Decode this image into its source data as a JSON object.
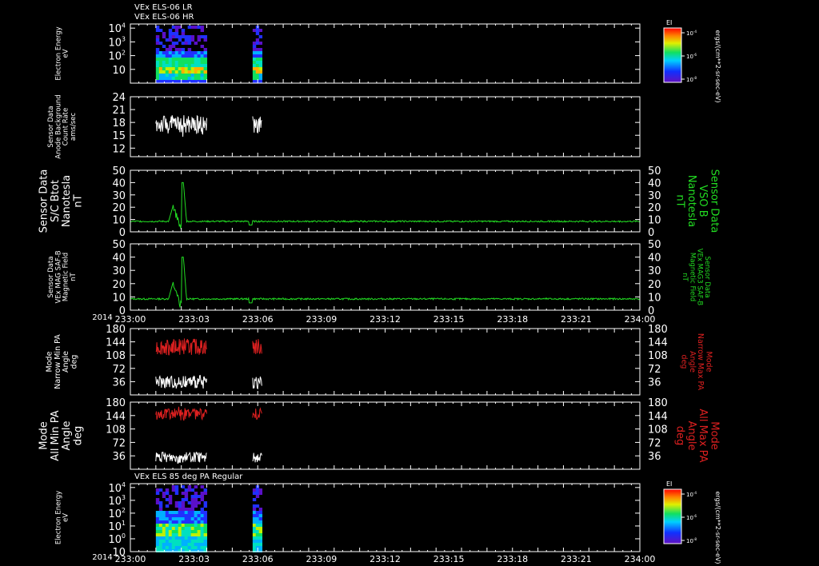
{
  "colors": {
    "white": "#ffffff",
    "green": "#22dd22",
    "red": "#dd2020",
    "background": "#000000"
  },
  "x_axis": {
    "year_label": "2014",
    "ticks": [
      "233:00",
      "233:03",
      "233:06",
      "233:09",
      "233:12",
      "233:15",
      "233:18",
      "233:21",
      "234:00"
    ],
    "range_minutes": [
      0,
      60
    ]
  },
  "chart_data": [
    {
      "type": "heatmap",
      "title_lines": [
        "VEx ELS-06 LR",
        "VEx ELS-06 HR"
      ],
      "ylabel": [
        "Electron Energy",
        "eV"
      ],
      "yticks": [
        {
          "base": "10",
          "exp": "4",
          "value": 10000
        },
        {
          "base": "10",
          "exp": "3",
          "value": 1000
        },
        {
          "base": "10",
          "exp": "2",
          "value": 100
        },
        {
          "base": "10",
          "exp": "",
          "value": 10
        }
      ],
      "ylim": [
        1,
        20000
      ],
      "yscale": "log",
      "time_intervals_minutes": [
        [
          3.0,
          9.0
        ],
        [
          14.4,
          15.5
        ]
      ],
      "colorbar": {
        "label": "EI",
        "unit": "ergs/(cm**2-sr-sec-eV)",
        "ticks": [
          {
            "base": "10",
            "exp": "-4"
          },
          {
            "base": "10",
            "exp": "-6"
          },
          {
            "base": "10",
            "exp": "-8"
          }
        ]
      }
    },
    {
      "type": "line",
      "ylabel": [
        "Sensor Data",
        "Anode Background",
        "Count Rate",
        "ams/sec"
      ],
      "yticks": [
        "24",
        "21",
        "18",
        "15",
        "12"
      ],
      "ylim": [
        10,
        24
      ],
      "series": [
        {
          "color": "white",
          "segments": [
            [
              3.0,
              9.0
            ],
            [
              14.4,
              15.5
            ]
          ],
          "mean": 17.5,
          "noise": 2.2
        }
      ]
    },
    {
      "type": "line",
      "ylabel": [
        "Sensor Data",
        "S/C Btot",
        "Nanotesla",
        "nT"
      ],
      "right_label": [
        "Sensor Data",
        "VSO B",
        "Nanotesla",
        "nT"
      ],
      "yticks": [
        "50",
        "40",
        "30",
        "20",
        "10",
        "0"
      ],
      "ylim": [
        0,
        50
      ],
      "series": [
        {
          "color": "green"
        }
      ]
    },
    {
      "type": "line",
      "ylabel": [
        "Sensor Data",
        "VEx MAG SAF-B",
        "Magnetic Field",
        "nT"
      ],
      "right_label": [
        "Sensor Data",
        "VEx MAG3 SAF-B",
        "Magnetic Field",
        "nT"
      ],
      "yticks": [
        "50",
        "40",
        "30",
        "20",
        "10",
        "0"
      ],
      "ylim": [
        0,
        50
      ],
      "series": [
        {
          "color": "green"
        }
      ]
    },
    {
      "type": "line",
      "ylabel": [
        "Mode",
        "Narrow Min PA",
        "Angle",
        "deg"
      ],
      "right_label": [
        "Mode",
        "Narrow Max PA",
        "Angle",
        "deg"
      ],
      "yticks": [
        "180",
        "144",
        "108",
        "72",
        "36"
      ],
      "ylim": [
        0,
        180
      ],
      "series": [
        {
          "color": "red",
          "segments": [
            [
              3.0,
              9.0
            ],
            [
              14.4,
              15.5
            ]
          ],
          "mean": 130,
          "noise": 22
        },
        {
          "color": "white",
          "segments": [
            [
              3.0,
              9.0
            ],
            [
              14.4,
              15.5
            ]
          ],
          "mean": 35,
          "noise": 18
        }
      ]
    },
    {
      "type": "line",
      "ylabel": [
        "Mode",
        "All Min PA",
        "Angle",
        "deg"
      ],
      "right_label": [
        "Mode",
        "All Max PA",
        "Angle",
        "deg"
      ],
      "yticks": [
        "180",
        "144",
        "108",
        "72",
        "36"
      ],
      "ylim": [
        0,
        180
      ],
      "series": [
        {
          "color": "red",
          "segments": [
            [
              3.0,
              9.0
            ],
            [
              14.4,
              15.5
            ]
          ],
          "mean": 148,
          "noise": 15
        },
        {
          "color": "white",
          "segments": [
            [
              3.0,
              9.0
            ],
            [
              14.4,
              15.5
            ]
          ],
          "mean": 32,
          "noise": 14
        }
      ]
    },
    {
      "type": "heatmap",
      "title_lines": [
        "VEx ELS 85 deg PA Regular"
      ],
      "ylabel": [
        "Electron Energy",
        "eV"
      ],
      "yticks": [
        {
          "base": "10",
          "exp": "4",
          "value": 10000
        },
        {
          "base": "10",
          "exp": "3",
          "value": 1000
        },
        {
          "base": "10",
          "exp": "2",
          "value": 100
        },
        {
          "base": "10",
          "exp": "1",
          "value": 10
        },
        {
          "base": "10",
          "exp": "0",
          "value": 1
        },
        {
          "base": "10",
          "exp": "",
          "value": 0.1
        }
      ],
      "ylim": [
        0.1,
        20000
      ],
      "yscale": "log",
      "time_intervals_minutes": [
        [
          3.0,
          9.0
        ],
        [
          14.4,
          15.5
        ]
      ],
      "colorbar": {
        "label": "EI",
        "unit": "ergs/(cm**2-sr-sec-eV)",
        "ticks": [
          {
            "base": "10",
            "exp": "-4"
          },
          {
            "base": "10",
            "exp": "-6"
          },
          {
            "base": "10",
            "exp": "-8"
          }
        ]
      }
    }
  ]
}
